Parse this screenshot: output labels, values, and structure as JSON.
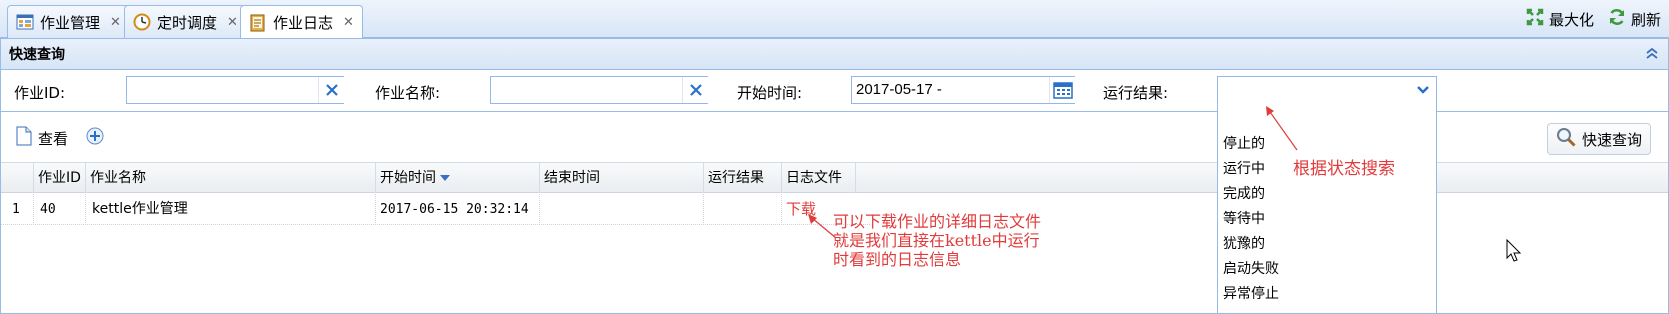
{
  "tabs": [
    {
      "label": "作业管理",
      "icon": "grid-icon"
    },
    {
      "label": "定时调度",
      "icon": "clock-icon"
    },
    {
      "label": "作业日志",
      "icon": "log-book-icon"
    }
  ],
  "window_tools": {
    "maximize": "最大化",
    "refresh": "刷新"
  },
  "panel": {
    "title": "快速查询"
  },
  "search": {
    "job_id_label": "作业ID:",
    "job_id_value": "",
    "job_name_label": "作业名称:",
    "job_name_value": "",
    "start_time_label": "开始时间:",
    "start_time_value": "2017-05-17 -",
    "result_label": "运行结果:",
    "result_value": ""
  },
  "toolbar": {
    "view_label": "查看",
    "quick_query_label": "快速查询"
  },
  "grid": {
    "columns": [
      "作业ID",
      "作业名称",
      "开始时间",
      "结束时间",
      "运行结果",
      "日志文件"
    ],
    "rows": [
      {
        "row_num": "1",
        "job_id": "40",
        "job_name": "kettle作业管理",
        "start_time": "2017-06-15 20:32:14",
        "end_time": "",
        "result": "",
        "log_file": "下载"
      }
    ]
  },
  "dropdown_options": [
    "停止的",
    "运行中",
    "完成的",
    "等待中",
    "犹豫的",
    "启动失败",
    "异常停止"
  ],
  "annotations": {
    "status_search": "根据状态搜索",
    "log_line1": "可以下载作业的详细日志文件",
    "log_line2": "就是我们直接在kettle中运行",
    "log_line3": "时看到的日志信息"
  },
  "colors": {
    "annotation": "#e23b3b",
    "border": "#99bbe8",
    "header_bg": "#dde9f8"
  }
}
